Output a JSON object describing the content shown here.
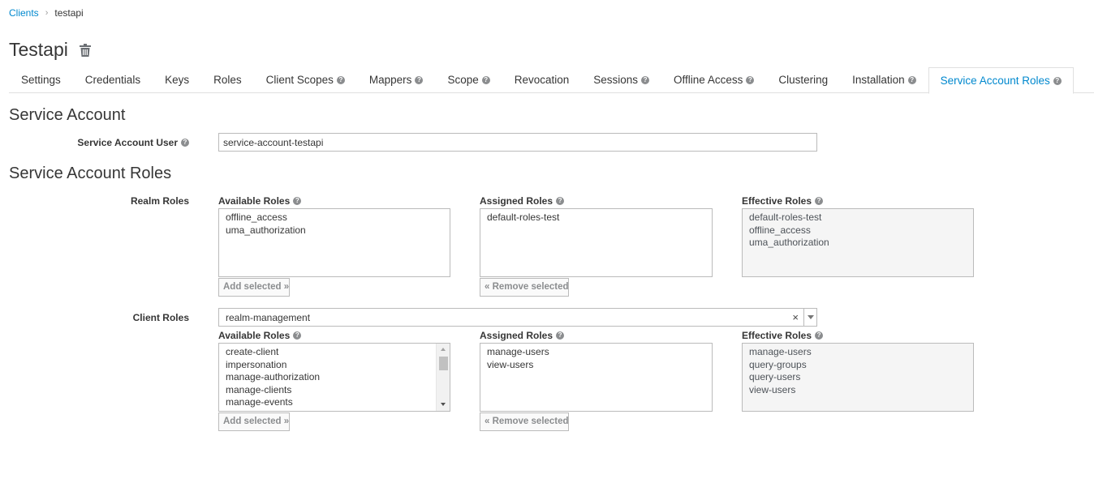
{
  "breadcrumb": {
    "parent": "Clients",
    "separator": "›",
    "current": "testapi"
  },
  "page": {
    "title": "Testapi",
    "delete_icon": "trash-icon"
  },
  "tabs": [
    {
      "label": "Settings",
      "help": false,
      "active": false
    },
    {
      "label": "Credentials",
      "help": false,
      "active": false
    },
    {
      "label": "Keys",
      "help": false,
      "active": false
    },
    {
      "label": "Roles",
      "help": false,
      "active": false
    },
    {
      "label": "Client Scopes",
      "help": true,
      "active": false
    },
    {
      "label": "Mappers",
      "help": true,
      "active": false
    },
    {
      "label": "Scope",
      "help": true,
      "active": false
    },
    {
      "label": "Revocation",
      "help": false,
      "active": false
    },
    {
      "label": "Sessions",
      "help": true,
      "active": false
    },
    {
      "label": "Offline Access",
      "help": true,
      "active": false
    },
    {
      "label": "Clustering",
      "help": false,
      "active": false
    },
    {
      "label": "Installation",
      "help": true,
      "active": false
    },
    {
      "label": "Service Account Roles",
      "help": true,
      "active": true
    }
  ],
  "help_glyph": "?",
  "service_account": {
    "heading": "Service Account",
    "user_label": "Service Account User",
    "user_value": "service-account-testapi"
  },
  "roles": {
    "heading": "Service Account Roles",
    "realm": {
      "label": "Realm Roles",
      "available_label": "Available Roles",
      "available": [
        "offline_access",
        "uma_authorization"
      ],
      "assigned_label": "Assigned Roles",
      "assigned": [
        "default-roles-test"
      ],
      "effective_label": "Effective Roles",
      "effective": [
        "default-roles-test",
        "offline_access",
        "uma_authorization"
      ],
      "add_button": "Add selected »",
      "remove_button": "« Remove selected"
    },
    "client": {
      "label": "Client Roles",
      "selected_client": "realm-management",
      "clear_glyph": "×",
      "available_label": "Available Roles",
      "available": [
        "create-client",
        "impersonation",
        "manage-authorization",
        "manage-clients",
        "manage-events"
      ],
      "assigned_label": "Assigned Roles",
      "assigned": [
        "manage-users",
        "view-users"
      ],
      "effective_label": "Effective Roles",
      "effective": [
        "manage-users",
        "query-groups",
        "query-users",
        "view-users"
      ],
      "add_button": "Add selected »",
      "remove_button": "« Remove selected"
    }
  },
  "colors": {
    "link": "#0088ce",
    "text": "#363636",
    "border": "#bbbbbb",
    "readonly_bg": "#f5f5f5"
  }
}
